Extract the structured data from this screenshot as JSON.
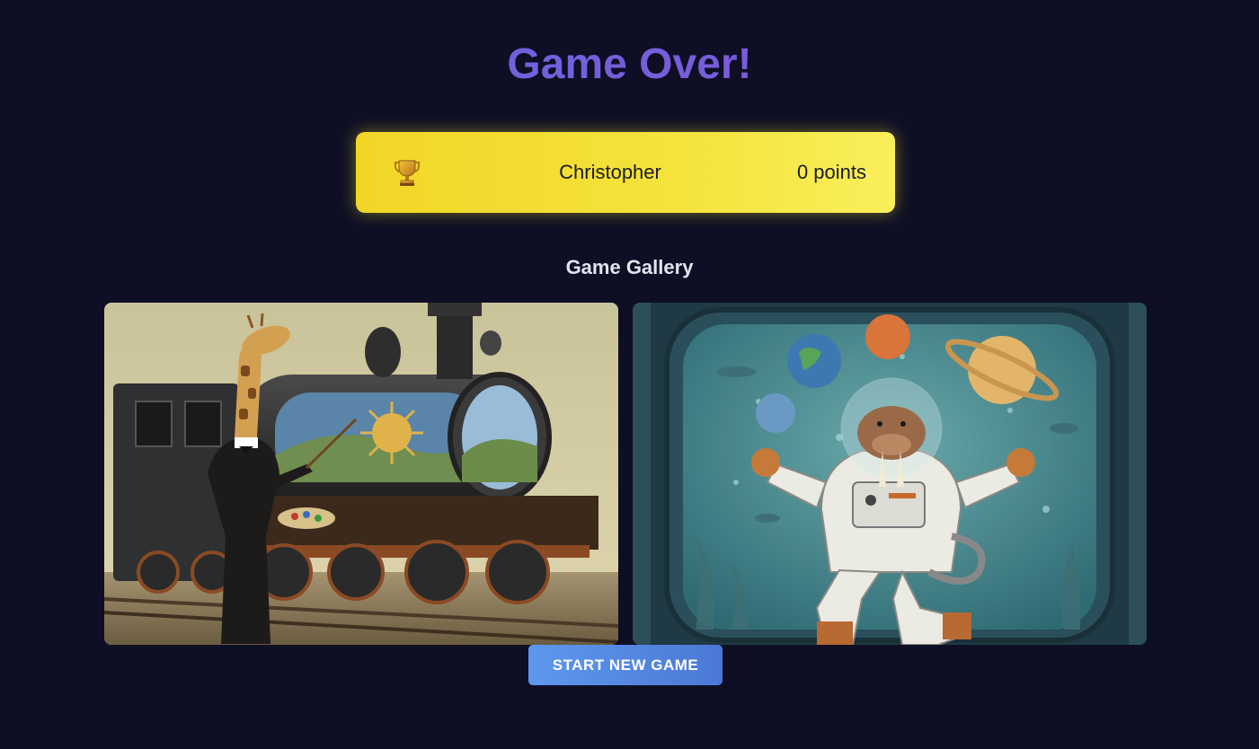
{
  "title": "Game Over!",
  "winner": {
    "icon": "trophy-icon",
    "name": "Christopher",
    "points": "0 points"
  },
  "gallery": {
    "title": "Game Gallery",
    "images": [
      {
        "name": "giraffe-painting-train-image"
      },
      {
        "name": "walrus-astronaut-juggling-planets-image"
      }
    ]
  },
  "actions": {
    "start_new_game": "START NEW GAME"
  },
  "colors": {
    "background": "#0e0f25",
    "title_gradient_start": "#5f6ee0",
    "title_gradient_end": "#8a4fd6",
    "winner_card": "#f3dd30",
    "button": "#5a8ee8"
  }
}
